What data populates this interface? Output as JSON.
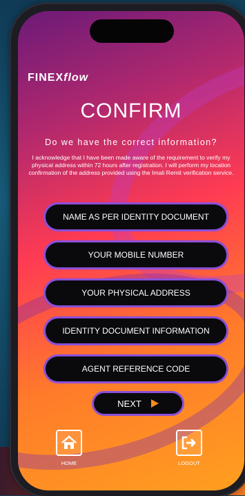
{
  "brand": {
    "name_part1": "FINEX",
    "name_part2": "flow"
  },
  "page": {
    "title": "CONFIRM",
    "question": "Do we have the correct information?",
    "acknowledgement": "I acknowledge that I have been made aware of the requirement to verify my physical address within 72 hours after registration. I will perform my location confirmation of the address provided using the Imali Remit verification service."
  },
  "fields": {
    "name": "NAME AS PER IDENTITY DOCUMENT",
    "mobile": "YOUR MOBILE NUMBER",
    "address": "YOUR PHYSICAL ADDRESS",
    "identity": "IDENTITY DOCUMENT INFORMATION",
    "agent": "AGENT REFERENCE CODE"
  },
  "actions": {
    "next": "NEXT"
  },
  "nav": {
    "home": "HOME",
    "logout": "LOGOUT"
  },
  "icons": {
    "home": "home-icon",
    "logout": "logout-icon",
    "next": "arrow-right-icon"
  },
  "colors": {
    "accent_border": "#8a4fd8",
    "next_arrow": "#ff8a1f",
    "field_bg": "#0a0a0d"
  }
}
